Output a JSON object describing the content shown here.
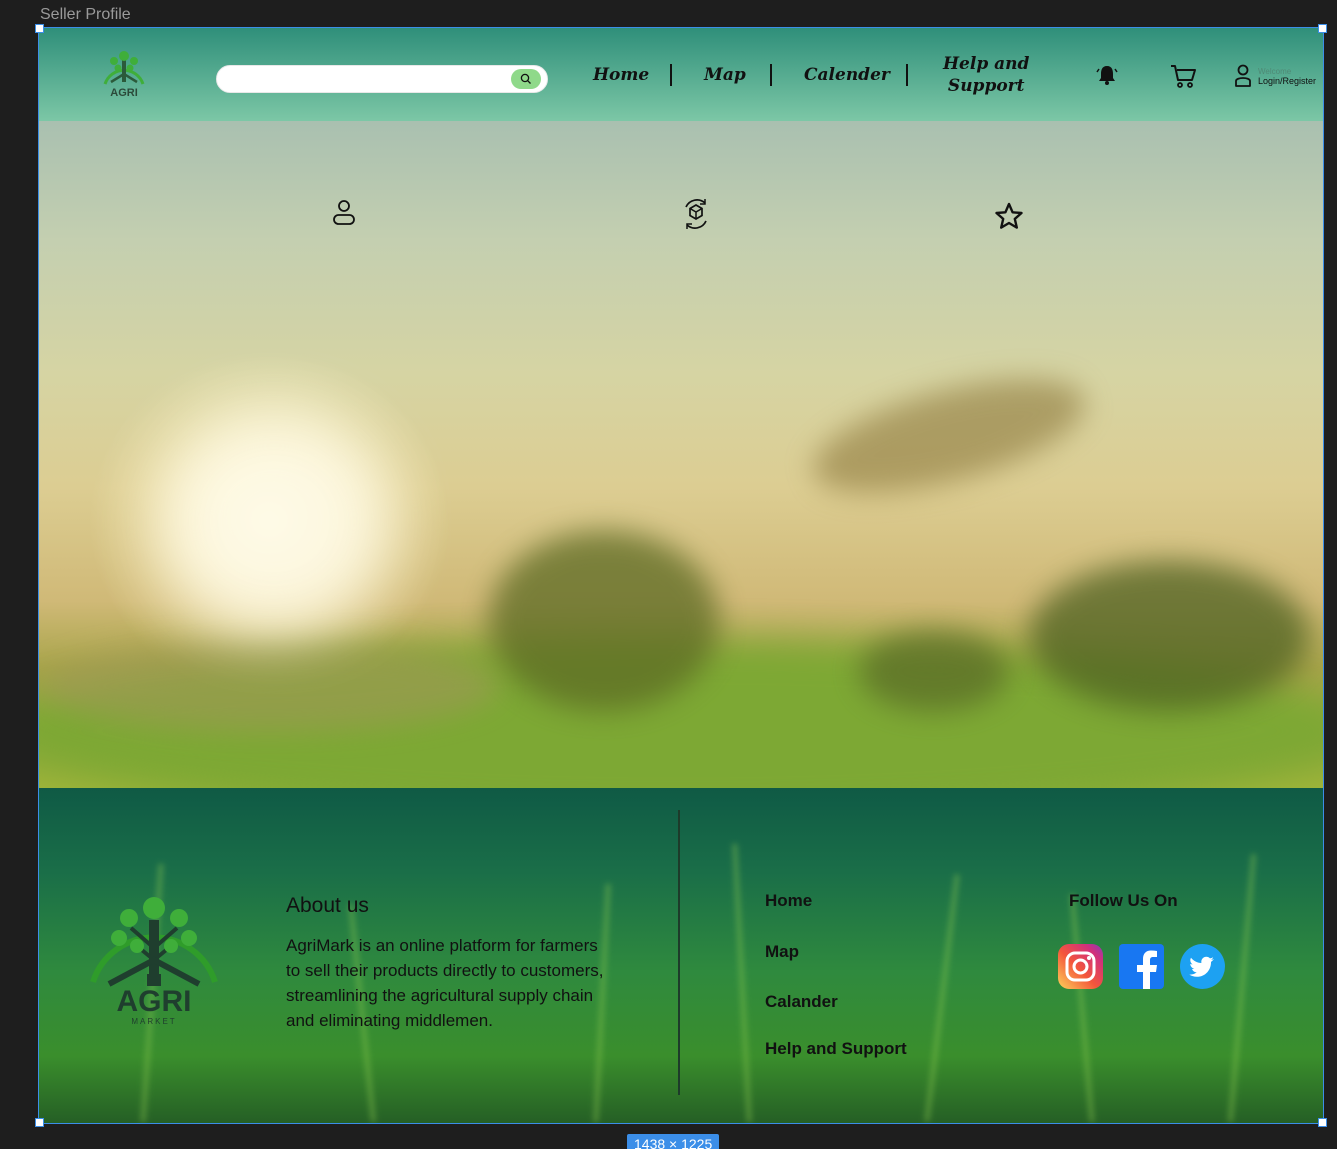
{
  "frame": {
    "title": "Seller Profile",
    "dimensions": "1438 × 1225"
  },
  "header": {
    "logo_text": "AGRI",
    "search": {
      "placeholder": "",
      "button_icon": "search-icon"
    },
    "nav": [
      {
        "label": "Home"
      },
      {
        "label": "Map"
      },
      {
        "label": "Calender"
      },
      {
        "label_line1": "Help and",
        "label_line2": "Support"
      }
    ],
    "icons": [
      "bell-icon",
      "cart-icon",
      "user-icon"
    ],
    "account": {
      "welcome": "Welcome",
      "login": "Login/Register"
    }
  },
  "hero": {
    "icons": [
      "user-icon",
      "hexagon-refresh-icon",
      "star-icon"
    ]
  },
  "footer": {
    "logo_text": "AGRI",
    "logo_subtext": "MARKET",
    "about_title": "About us",
    "about_text": "AgriMark is an online platform for farmers to sell their products directly to customers, streamlining the agricultural supply chain and eliminating middlemen.",
    "links": [
      "Home",
      "Map",
      "Calander",
      "Help and Support"
    ],
    "follow_title": "Follow Us On",
    "socials": [
      "instagram-icon",
      "facebook-icon",
      "twitter-icon"
    ]
  },
  "colors": {
    "header_top": "#2f8f7a",
    "header_bottom": "#7cc7a6",
    "selection": "#3b8ee8",
    "search_button": "#8fd98a"
  }
}
